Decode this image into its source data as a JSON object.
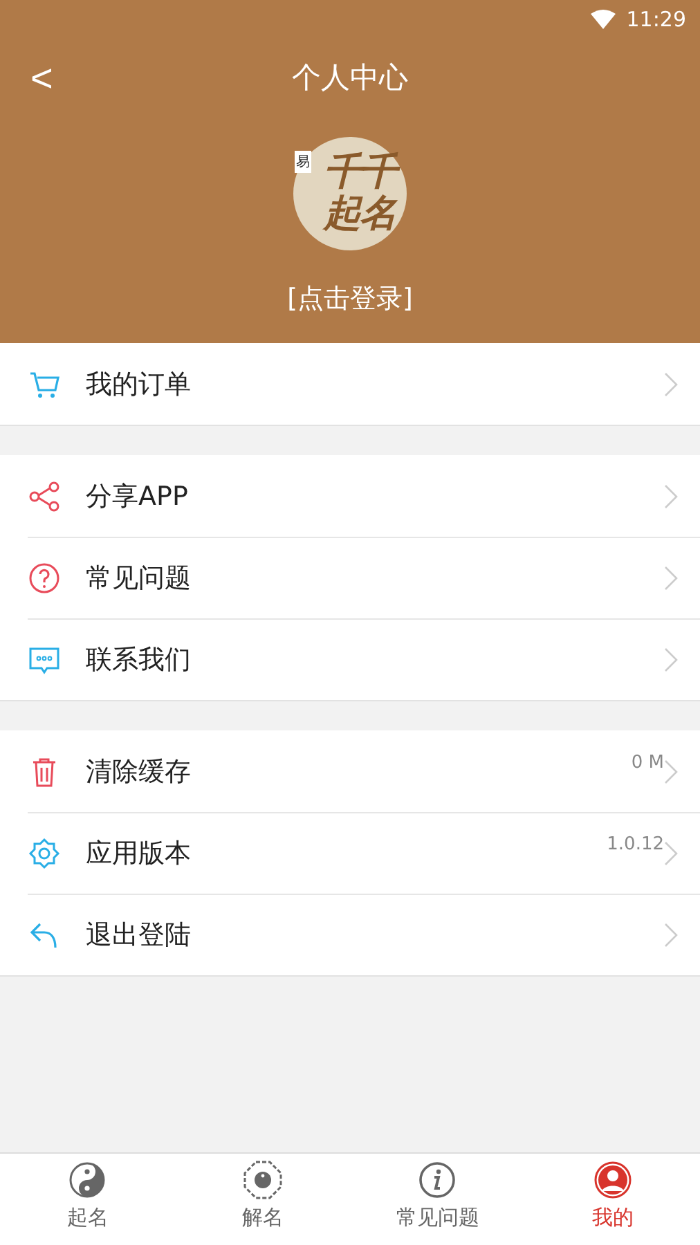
{
  "status_bar": {
    "time": "11:29"
  },
  "header": {
    "title": "个人中心",
    "back": "<",
    "avatar": {
      "logo_lines": [
        "千千",
        "起名"
      ],
      "tag": "易"
    },
    "login": "[点击登录]"
  },
  "sections": [
    [
      {
        "label": "我的订单"
      }
    ],
    [
      {
        "label": "分享APP"
      },
      {
        "label": "常见问题"
      },
      {
        "label": "联系我们"
      }
    ],
    [
      {
        "label": "清除缓存",
        "value": "0 M"
      },
      {
        "label": "应用版本",
        "value": "1.0.12"
      },
      {
        "label": "退出登陆"
      }
    ]
  ],
  "tabs": [
    {
      "label": "起名",
      "selected": false
    },
    {
      "label": "解名",
      "selected": false
    },
    {
      "label": "常见问题",
      "selected": false
    },
    {
      "label": "我的",
      "selected": true
    }
  ]
}
